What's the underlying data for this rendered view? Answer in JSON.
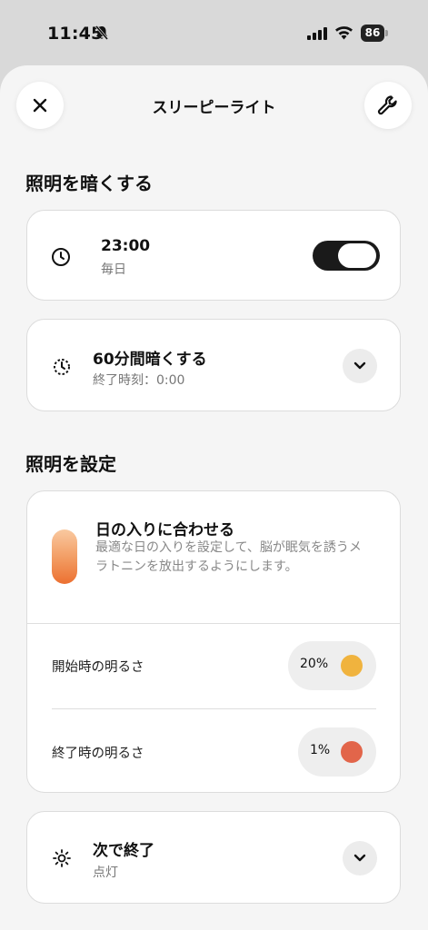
{
  "status_bar": {
    "time": "11:45",
    "battery": "86"
  },
  "header": {
    "title": "スリーピーライト"
  },
  "dim_section": {
    "title": "照明を暗くする",
    "schedule": {
      "time": "23:00",
      "repeat": "毎日",
      "enabled": true
    },
    "duration": {
      "label": "60分間暗くする",
      "end_time": "終了時刻：0:00"
    }
  },
  "light_section": {
    "title": "照明を設定",
    "sunset": {
      "title": "日の入りに合わせる",
      "description": "最適な日の入りを設定して、脳が眠気を誘うメラトニンを放出するようにします。"
    },
    "start_brightness": {
      "label": "開始時の明るさ",
      "value": "20%",
      "color": "#f0b33e"
    },
    "end_brightness": {
      "label": "終了時の明るさ",
      "value": "1%",
      "color": "#e2654a"
    }
  },
  "next_end": {
    "label": "次で終了",
    "value": "点灯"
  }
}
